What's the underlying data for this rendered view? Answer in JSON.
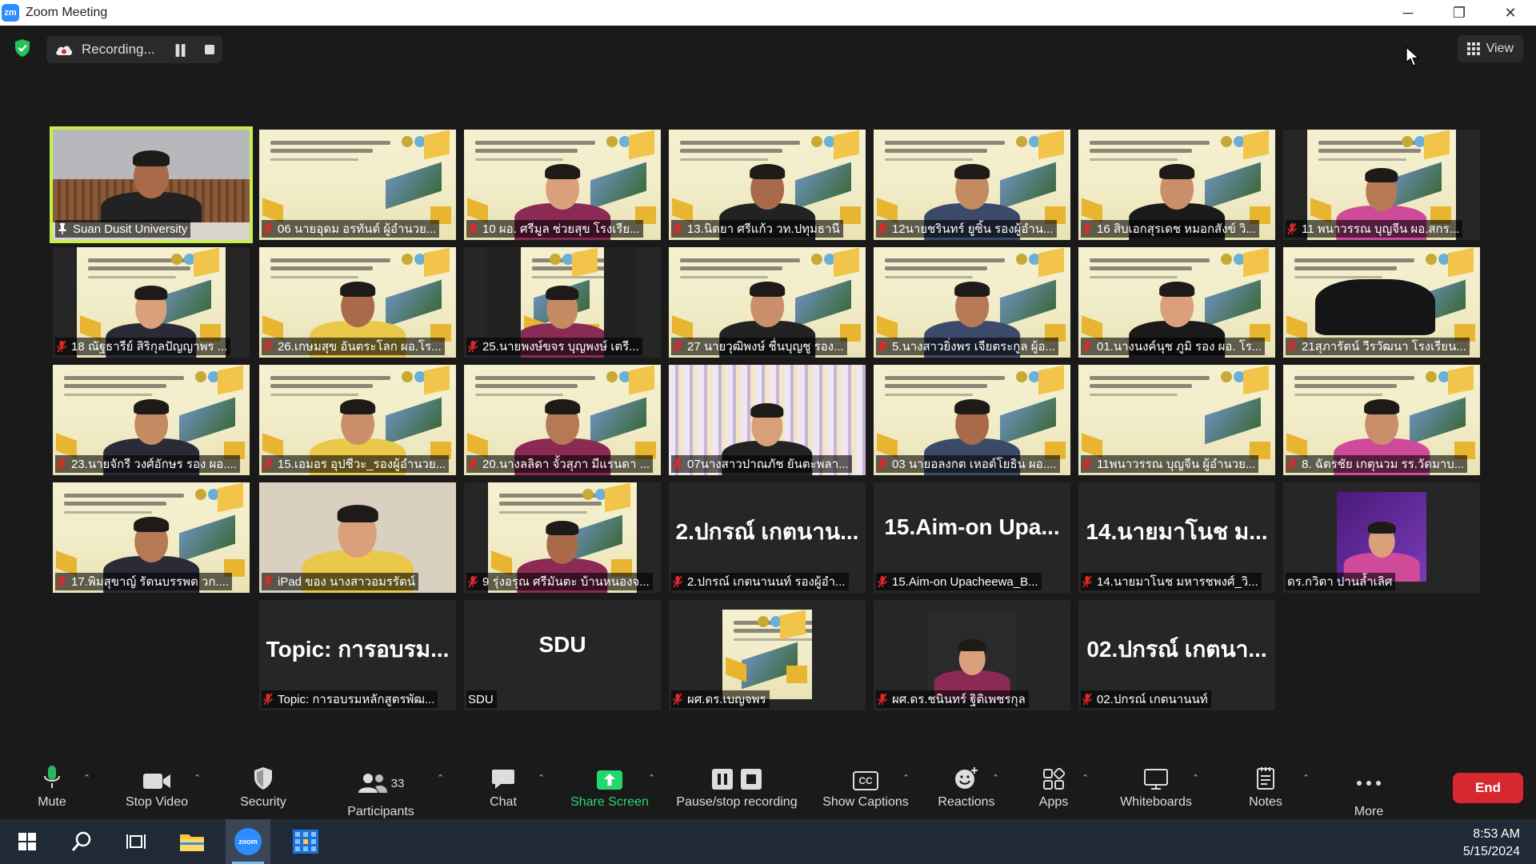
{
  "window": {
    "title": "Zoom Meeting",
    "logo_text": "zm",
    "minimize": "─",
    "restore": "❐",
    "close": "✕"
  },
  "status": {
    "recording_label": "Recording...",
    "view_label": "View"
  },
  "participants": [
    {
      "name": "Suan Dusit University",
      "pinned": true,
      "muted": false
    },
    {
      "name": "06 นายอุดม อรทันต์ ผู้อำนวย...",
      "muted": true
    },
    {
      "name": "10 ผอ. ศรีมูล  ช่วยสุข โรงเรีย...",
      "muted": true
    },
    {
      "name": "13.นิตยา ศรีแก้ว วท.ปทุมธานี",
      "muted": true
    },
    {
      "name": "12นายชรินทร์ ยูซิ้น รองผู้อำน...",
      "muted": true
    },
    {
      "name": "16 สิบเอกสุรเดช  หมอกสังข์ วิ...",
      "muted": true
    },
    {
      "name": "11 พนาวรรณ บุญจีน ผอ.สกร...",
      "muted": true
    },
    {
      "name": "18 ณัฐธารีย์ สิริกุลปัญญาพร ...",
      "muted": true
    },
    {
      "name": "26.เกษมสุข อันตระโลก ผอ.โร...",
      "muted": true
    },
    {
      "name": "25.นายพงษ์ขจร บุญพงษ์ เตรี...",
      "muted": true
    },
    {
      "name": "27 นายวุฒิพงษ์  ชื่นบุญชู รอง...",
      "muted": true
    },
    {
      "name": "5.นางสาวยิ่งพร เจียตระกูล ผู้อ...",
      "muted": true
    },
    {
      "name": "01.นางนงค์นุช ภูมิ รอง ผอ. โร...",
      "muted": true
    },
    {
      "name": "21สุภารัตน์ วีรวัฒนา โรงเรียน...",
      "muted": true
    },
    {
      "name": "23.นายจักรี วงศ์อักษร รอง ผอ....",
      "muted": true
    },
    {
      "name": "15.เอมอร อุปชีวะ_รองผู้อำนวย...",
      "muted": true
    },
    {
      "name": "20.นางลลิดา จั้วสุภา มีแรนดา ...",
      "muted": true
    },
    {
      "name": "07นางสาวปาณภัช  ยันตะพลา...",
      "muted": true
    },
    {
      "name": "03 นายอลงกต เหอต์โยธิน ผอ....",
      "muted": true
    },
    {
      "name": "11พนาวรรณ บุญจีน ผู้อำนวย...",
      "muted": true
    },
    {
      "name": "8. ฉัตรชัย เกตุนวม  รร.วัดมาบ...",
      "muted": true
    },
    {
      "name": "17.พิมสุขาญ์ รัตนบรรพต วก....",
      "muted": true
    },
    {
      "name": "iPad ของ นางสาวอมรรัตน์",
      "muted": true
    },
    {
      "name": "9 รุ่งอรุณ ศรีมันตะ บ้านหนองจ...",
      "muted": true
    },
    {
      "name": "2.ปกรณ์ เกตนานนท์ รองผู้อำ...",
      "muted": true,
      "big": "2.ปกรณ์ เกตนาน..."
    },
    {
      "name": "15.Aim-on Upacheewa_B...",
      "muted": true,
      "big": "15.Aim-on  Upa..."
    },
    {
      "name": "14.นายมาโนช มหารชพงศ์_วิ...",
      "muted": true,
      "big": "14.นายมาโนช ม..."
    },
    {
      "name": "ดร.กวิตา ปานล้ำเลิศ",
      "muted": false
    },
    {
      "name": "Topic: การอบรมหลักสูตรพัฒ...",
      "muted": true,
      "big": "Topic: การอบรม..."
    },
    {
      "name": "SDU",
      "muted": false,
      "big": "SDU"
    },
    {
      "name": "ผศ.ดร.เบญจพร",
      "muted": true
    },
    {
      "name": "ผศ.ดร.ชนินทร์ ฐิติเพชรกุล",
      "muted": true
    },
    {
      "name": "02.ปกรณ์ เกตนานนท์",
      "muted": true,
      "big": "02.ปกรณ์ เกตนา..."
    }
  ],
  "toolbar": {
    "mute": "Mute",
    "stop_video": "Stop Video",
    "security": "Security",
    "participants": "Participants",
    "participants_count": "33",
    "chat": "Chat",
    "share_screen": "Share Screen",
    "pause_recording": "Pause/stop recording",
    "captions": "Show Captions",
    "captions_icon_text": "CC",
    "reactions": "Reactions",
    "apps": "Apps",
    "whiteboards": "Whiteboards",
    "notes": "Notes",
    "more": "More",
    "end": "End"
  },
  "taskbar": {
    "zoom_label": "zoom",
    "time": "8:53 AM",
    "date": "5/15/2024"
  },
  "colors": {
    "active_speaker": "#c7f04f",
    "end_button": "#d7282e",
    "share_green": "#23d96d",
    "muted_red": "#e02828"
  }
}
